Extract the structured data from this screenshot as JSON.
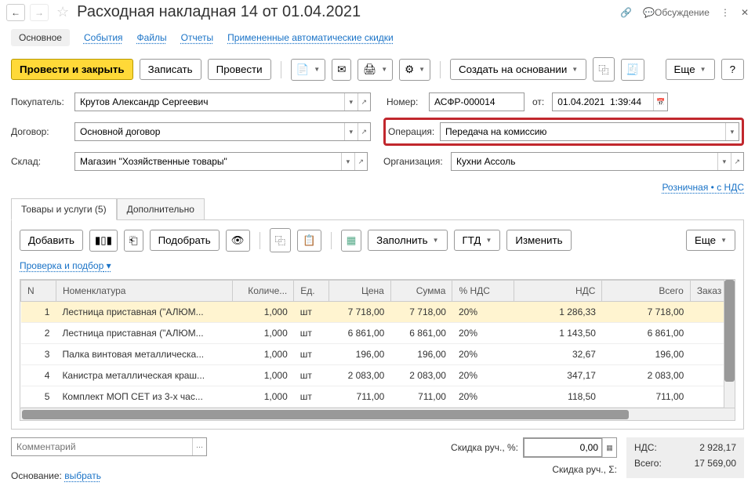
{
  "header": {
    "title": "Расходная накладная 14 от 01.04.2021",
    "discuss": "Обсуждение"
  },
  "topTabs": {
    "main": "Основное",
    "events": "События",
    "files": "Файлы",
    "reports": "Отчеты",
    "discounts": "Примененные автоматические скидки"
  },
  "toolbar": {
    "postClose": "Провести и закрыть",
    "save": "Записать",
    "post": "Провести",
    "createBase": "Создать на основании",
    "fill": "Заполнить",
    "gtd": "ГТД",
    "change": "Изменить",
    "more": "Еще",
    "help": "?",
    "add": "Добавить",
    "pick": "Подобрать"
  },
  "form": {
    "buyerLabel": "Покупатель:",
    "buyer": "Крутов Александр Сергеевич",
    "contractLabel": "Договор:",
    "contract": "Основной договор",
    "warehouseLabel": "Склад:",
    "warehouse": "Магазин \"Хозяйственные товары\"",
    "numberLabel": "Номер:",
    "number": "АСФР-000014",
    "fromLabel": "от:",
    "date": "01.04.2021  1:39:44",
    "operationLabel": "Операция:",
    "operation": "Передача на комиссию",
    "orgLabel": "Организация:",
    "org": "Кухни Ассоль",
    "retailLink": "Розничная • с НДС"
  },
  "subTabs": {
    "goods": "Товары и услуги (5)",
    "extra": "Дополнительно"
  },
  "checkLink": "Проверка и подбор",
  "columns": {
    "n": "N",
    "nomen": "Номенклатура",
    "qty": "Количе...",
    "unit": "Ед.",
    "price": "Цена",
    "sum": "Сумма",
    "vatPct": "% НДС",
    "vat": "НДС",
    "total": "Всего",
    "order": "Заказ"
  },
  "rows": [
    {
      "n": "1",
      "nomen": "Лестница приставная (\"АЛЮМ...",
      "qty": "1,000",
      "unit": "шт",
      "price": "7 718,00",
      "sum": "7 718,00",
      "vatPct": "20%",
      "vat": "1 286,33",
      "total": "7 718,00"
    },
    {
      "n": "2",
      "nomen": "Лестница приставная (\"АЛЮМ...",
      "qty": "1,000",
      "unit": "шт",
      "price": "6 861,00",
      "sum": "6 861,00",
      "vatPct": "20%",
      "vat": "1 143,50",
      "total": "6 861,00"
    },
    {
      "n": "3",
      "nomen": "Палка винтовая металлическа...",
      "qty": "1,000",
      "unit": "шт",
      "price": "196,00",
      "sum": "196,00",
      "vatPct": "20%",
      "vat": "32,67",
      "total": "196,00"
    },
    {
      "n": "4",
      "nomen": "Канистра металлическая краш...",
      "qty": "1,000",
      "unit": "шт",
      "price": "2 083,00",
      "sum": "2 083,00",
      "vatPct": "20%",
      "vat": "347,17",
      "total": "2 083,00"
    },
    {
      "n": "5",
      "nomen": "Комплект МОП СЕТ из 3-х час...",
      "qty": "1,000",
      "unit": "шт",
      "price": "711,00",
      "sum": "711,00",
      "vatPct": "20%",
      "vat": "118,50",
      "total": "711,00"
    }
  ],
  "footer": {
    "commentPlaceholder": "Комментарий",
    "discPctLabel": "Скидка руч., %:",
    "discPct": "0,00",
    "discSumLabel": "Скидка руч., Σ:",
    "vatLabel": "НДС:",
    "vatTotal": "2 928,17",
    "totalLabel": "Всего:",
    "total": "17 569,00",
    "baseLabel": "Основание:",
    "baseLink": "выбрать"
  }
}
